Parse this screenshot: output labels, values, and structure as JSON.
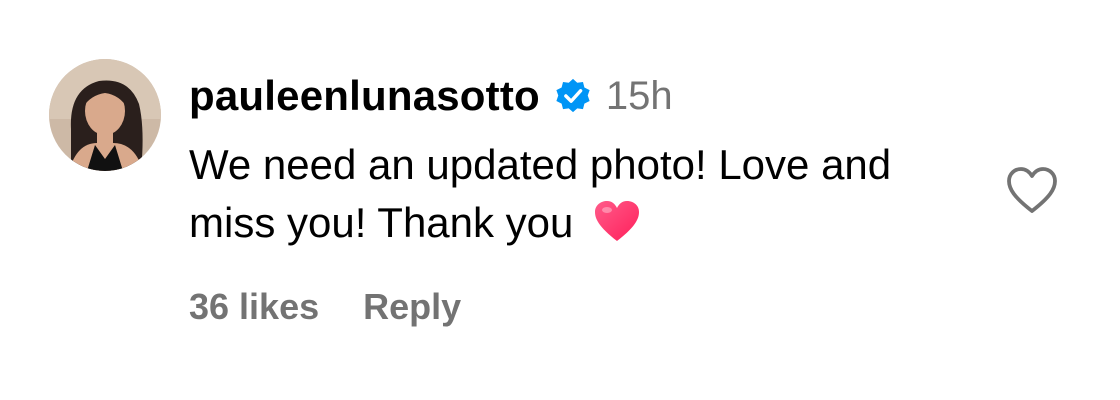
{
  "comment": {
    "username": "pauleenlunasotto",
    "verified": true,
    "timestamp": "15h",
    "text": "We need an updated photo! Love and miss you! Thank you",
    "emoji": "heart-emoji",
    "likes": "36 likes",
    "reply_label": "Reply"
  },
  "colors": {
    "verified_badge": "#0095f6",
    "muted_text": "#737373",
    "heart_emoji": "#ff2d6f"
  },
  "icons": {
    "verified": "verified-badge-icon",
    "like": "heart-outline-icon"
  }
}
